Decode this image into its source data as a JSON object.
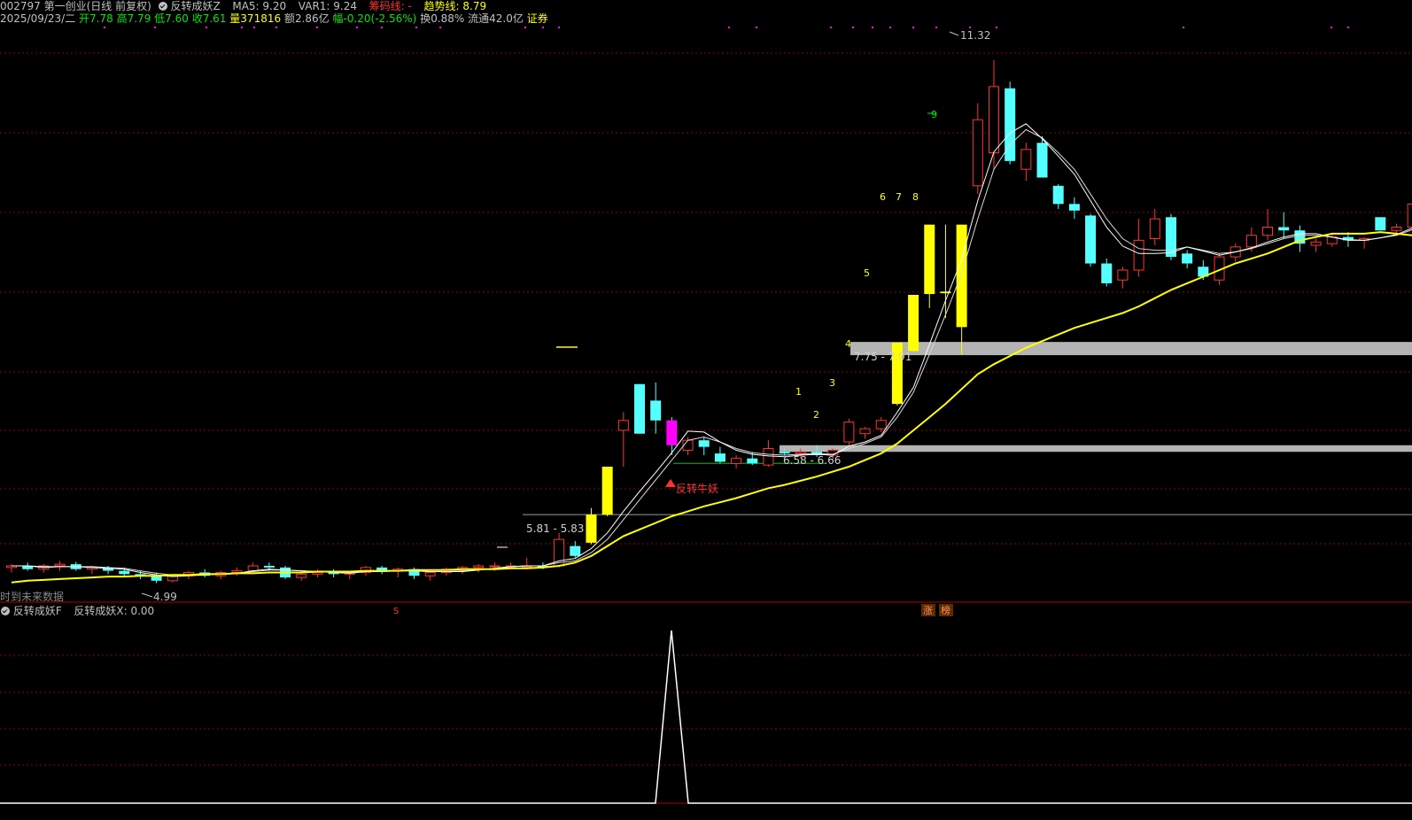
{
  "header": {
    "stock": "002797 第一创业(日线 前复权)",
    "indicator": "反转成妖Z",
    "ma5": "MA5: 9.20",
    "var1": "VAR1: 9.24",
    "chip_line": "筹码线: -",
    "trend_line": "趋势线: 8.79"
  },
  "quote": {
    "date": "2025/09/23/二",
    "open": "开7.78",
    "high": "高7.79",
    "low": "低7.60",
    "close": "收7.61",
    "volume": "量371816",
    "amount": "额2.86亿",
    "change": "幅-0.20(-2.56%)",
    "turnover": "换0.88%",
    "float": "流通42.0亿",
    "sector": "证券"
  },
  "lower": {
    "indicator": "反转成妖F",
    "value": "反转成妖X: 0.00"
  },
  "main_labels": {
    "peak": "11.32",
    "low": "4.99",
    "zone_high": "7.75 - 7.91",
    "zone_mid": "6.58 - 6.66",
    "zone_low": "5.81 - 5.83",
    "signal": "反转牛妖",
    "future": "时到未来数据",
    "s_mark": "S",
    "zhang": "涨",
    "bang": "榜"
  },
  "counts": [
    "1",
    "2",
    "3",
    "4",
    "5",
    "6",
    "7",
    "8",
    "9"
  ],
  "colors": {
    "background": "#000000",
    "up": "#ff3232",
    "down": "#54ffff",
    "signal_bar": "#ffff00",
    "trend_line": "#ffff00",
    "grid": "#8b0000",
    "header_white": "#c0c0c0",
    "header_green": "#00e600",
    "header_yellow": "#ffff00",
    "header_red": "#ff3232",
    "header_magenta": "#ff00ff"
  },
  "chart_data": {
    "type": "candlestick",
    "title": "002797 第一创业(日线 前复权)",
    "peak_annotation": 11.32,
    "low_annotation": 4.99,
    "ohlc": [
      [
        5.18,
        5.22,
        5.12,
        5.2
      ],
      [
        5.2,
        5.24,
        5.14,
        5.16
      ],
      [
        5.16,
        5.22,
        5.12,
        5.2
      ],
      [
        5.2,
        5.26,
        5.14,
        5.22
      ],
      [
        5.22,
        5.25,
        5.14,
        5.16
      ],
      [
        5.16,
        5.2,
        5.1,
        5.18
      ],
      [
        5.18,
        5.2,
        5.1,
        5.14
      ],
      [
        5.14,
        5.18,
        5.08,
        5.1
      ],
      [
        5.1,
        5.14,
        5.04,
        5.08
      ],
      [
        5.08,
        5.12,
        4.99,
        5.02
      ],
      [
        5.02,
        5.1,
        5.0,
        5.08
      ],
      [
        5.08,
        5.14,
        5.04,
        5.12
      ],
      [
        5.12,
        5.16,
        5.06,
        5.08
      ],
      [
        5.08,
        5.14,
        5.04,
        5.12
      ],
      [
        5.12,
        5.18,
        5.08,
        5.14
      ],
      [
        5.14,
        5.24,
        5.1,
        5.2
      ],
      [
        5.2,
        5.24,
        5.14,
        5.18
      ],
      [
        5.18,
        5.2,
        5.04,
        5.06
      ],
      [
        5.06,
        5.12,
        5.02,
        5.1
      ],
      [
        5.1,
        5.16,
        5.06,
        5.12
      ],
      [
        5.12,
        5.16,
        5.06,
        5.1
      ],
      [
        5.1,
        5.14,
        5.04,
        5.12
      ],
      [
        5.12,
        5.2,
        5.08,
        5.18
      ],
      [
        5.18,
        5.2,
        5.1,
        5.14
      ],
      [
        5.14,
        5.18,
        5.06,
        5.16
      ],
      [
        5.16,
        5.18,
        5.04,
        5.08
      ],
      [
        5.08,
        5.14,
        5.02,
        5.12
      ],
      [
        5.12,
        5.18,
        5.08,
        5.16
      ],
      [
        5.16,
        5.2,
        5.1,
        5.18
      ],
      [
        5.18,
        5.22,
        5.12,
        5.2
      ],
      [
        5.2,
        5.24,
        5.14,
        5.2
      ],
      [
        5.2,
        5.24,
        5.16,
        5.2
      ],
      [
        5.2,
        5.3,
        5.16,
        5.2
      ],
      [
        5.2,
        5.24,
        5.16,
        5.18
      ],
      [
        5.2,
        5.6,
        5.18,
        5.52
      ],
      [
        5.44,
        5.5,
        5.3,
        5.32
      ],
      [
        5.48,
        5.9,
        5.46,
        5.82
      ],
      [
        5.82,
        6.4,
        5.8,
        6.4
      ],
      [
        6.84,
        7.06,
        6.4,
        6.96
      ],
      [
        7.4,
        7.4,
        6.8,
        6.8
      ],
      [
        7.2,
        7.42,
        6.8,
        6.96
      ],
      [
        6.96,
        7.0,
        6.54,
        6.66
      ],
      [
        6.6,
        6.76,
        6.54,
        6.72
      ],
      [
        6.72,
        6.76,
        6.54,
        6.64
      ],
      [
        6.56,
        6.64,
        6.44,
        6.46
      ],
      [
        6.44,
        6.54,
        6.38,
        6.5
      ],
      [
        6.5,
        6.58,
        6.42,
        6.44
      ],
      [
        6.42,
        6.72,
        6.4,
        6.62
      ],
      [
        6.58,
        6.62,
        6.54,
        6.56
      ],
      [
        6.56,
        6.62,
        6.5,
        6.58
      ],
      [
        6.58,
        6.66,
        6.52,
        6.54
      ],
      [
        6.54,
        6.62,
        6.48,
        6.6
      ],
      [
        6.7,
        6.98,
        6.66,
        6.94
      ],
      [
        6.8,
        6.88,
        6.74,
        6.86
      ],
      [
        6.86,
        7.0,
        6.82,
        6.96
      ],
      [
        7.16,
        7.9,
        7.14,
        7.9
      ],
      [
        7.8,
        8.48,
        7.8,
        8.48
      ],
      [
        9.33,
        9.33,
        8.32,
        8.49
      ],
      [
        8.5,
        9.33,
        8.2,
        8.52
      ],
      [
        8.09,
        9.33,
        7.76,
        9.33
      ],
      [
        9.8,
        10.8,
        9.7,
        10.6
      ],
      [
        10.2,
        11.32,
        10.0,
        11.0
      ],
      [
        10.98,
        11.06,
        10.06,
        10.1
      ],
      [
        10.0,
        10.32,
        9.86,
        10.24
      ],
      [
        10.32,
        10.4,
        9.9,
        9.9
      ],
      [
        9.8,
        9.82,
        9.52,
        9.58
      ],
      [
        9.58,
        9.66,
        9.4,
        9.5
      ],
      [
        9.44,
        9.46,
        8.82,
        8.86
      ],
      [
        8.86,
        8.92,
        8.58,
        8.62
      ],
      [
        8.66,
        8.82,
        8.56,
        8.78
      ],
      [
        8.78,
        9.4,
        8.7,
        9.14
      ],
      [
        9.16,
        9.52,
        9.08,
        9.4
      ],
      [
        9.42,
        9.46,
        8.9,
        8.94
      ],
      [
        8.98,
        9.02,
        8.8,
        8.86
      ],
      [
        8.82,
        8.9,
        8.66,
        8.7
      ],
      [
        8.66,
        8.98,
        8.6,
        8.94
      ],
      [
        8.94,
        9.1,
        8.88,
        9.06
      ],
      [
        9.06,
        9.3,
        9.0,
        9.2
      ],
      [
        9.2,
        9.52,
        9.14,
        9.3
      ],
      [
        9.3,
        9.48,
        9.16,
        9.26
      ],
      [
        9.26,
        9.32,
        9.0,
        9.1
      ],
      [
        9.08,
        9.16,
        9.0,
        9.12
      ],
      [
        9.1,
        9.22,
        9.06,
        9.18
      ],
      [
        9.18,
        9.24,
        9.06,
        9.14
      ],
      [
        9.14,
        9.18,
        9.04,
        9.16
      ],
      [
        9.42,
        9.42,
        9.26,
        9.26
      ],
      [
        9.26,
        9.34,
        9.2,
        9.3
      ],
      [
        9.3,
        9.66,
        9.26,
        9.58
      ],
      [
        9.58,
        9.9,
        9.5,
        9.7
      ],
      [
        9.7,
        10.0,
        9.6,
        9.76
      ]
    ],
    "signal_days": [
      36,
      37,
      55,
      56,
      57,
      58,
      59
    ],
    "trend_line": [
      5.0,
      5.02,
      5.03,
      5.04,
      5.05,
      5.06,
      5.07,
      5.07,
      5.08,
      5.08,
      5.09,
      5.09,
      5.1,
      5.1,
      5.11,
      5.11,
      5.12,
      5.12,
      5.12,
      5.13,
      5.13,
      5.13,
      5.14,
      5.14,
      5.14,
      5.15,
      5.15,
      5.15,
      5.16,
      5.16,
      5.16,
      5.17,
      5.17,
      5.18,
      5.2,
      5.24,
      5.32,
      5.44,
      5.56,
      5.64,
      5.72,
      5.8,
      5.86,
      5.92,
      5.97,
      6.02,
      6.08,
      6.14,
      6.18,
      6.23,
      6.28,
      6.34,
      6.4,
      6.48,
      6.56,
      6.68,
      6.84,
      7.0,
      7.16,
      7.34,
      7.52,
      7.64,
      7.74,
      7.84,
      7.92,
      8.0,
      8.08,
      8.14,
      8.2,
      8.26,
      8.34,
      8.44,
      8.54,
      8.62,
      8.7,
      8.78,
      8.86,
      8.92,
      8.98,
      9.06,
      9.14,
      9.18,
      9.22,
      9.22,
      9.22,
      9.24,
      9.22,
      9.2,
      9.12,
      9.12,
      9.12
    ],
    "ma5": [
      5.2,
      5.2,
      5.18,
      5.19,
      5.19,
      5.18,
      5.17,
      5.16,
      5.12,
      5.09,
      5.07,
      5.08,
      5.09,
      5.1,
      5.11,
      5.14,
      5.16,
      5.15,
      5.14,
      5.13,
      5.12,
      5.11,
      5.13,
      5.13,
      5.14,
      5.14,
      5.13,
      5.13,
      5.13,
      5.15,
      5.17,
      5.19,
      5.2,
      5.2,
      5.26,
      5.29,
      5.41,
      5.6,
      5.86,
      6.1,
      6.33,
      6.57,
      6.83,
      6.82,
      6.7,
      6.6,
      6.55,
      6.53,
      6.52,
      6.54,
      6.55,
      6.54,
      6.65,
      6.7,
      6.78,
      7.06,
      7.36,
      7.88,
      8.41,
      8.91,
      9.62,
      10.21,
      10.44,
      10.55,
      10.37,
      10.16,
      9.94,
      9.62,
      9.3,
      9.07,
      8.98,
      8.98,
      8.99,
      9.06,
      9.01,
      8.96,
      9.0,
      9.05,
      9.12,
      9.18,
      9.22,
      9.22,
      9.18,
      9.14,
      9.14,
      9.17,
      9.21,
      9.29,
      9.43,
      9.55
    ],
    "var1": [
      5.2,
      5.2,
      5.19,
      5.19,
      5.19,
      5.19,
      5.18,
      5.17,
      5.14,
      5.11,
      5.09,
      5.09,
      5.09,
      5.1,
      5.11,
      5.13,
      5.15,
      5.15,
      5.14,
      5.13,
      5.13,
      5.12,
      5.13,
      5.13,
      5.14,
      5.14,
      5.13,
      5.13,
      5.14,
      5.15,
      5.17,
      5.19,
      5.2,
      5.2,
      5.24,
      5.26,
      5.36,
      5.52,
      5.76,
      6.0,
      6.24,
      6.48,
      6.72,
      6.76,
      6.7,
      6.62,
      6.57,
      6.55,
      6.54,
      6.55,
      6.56,
      6.55,
      6.62,
      6.68,
      6.76,
      7.0,
      7.3,
      7.76,
      8.24,
      8.74,
      9.4,
      10.0,
      10.3,
      10.48,
      10.38,
      10.2,
      10.0,
      9.7,
      9.4,
      9.16,
      9.04,
      9.02,
      9.02,
      9.06,
      9.02,
      8.98,
      9.0,
      9.04,
      9.1,
      9.16,
      9.2,
      9.2,
      9.18,
      9.15,
      9.14,
      9.17,
      9.2,
      9.27,
      9.38,
      9.5
    ],
    "zones": [
      [
        7.75,
        7.91
      ],
      [
        6.58,
        6.66
      ],
      [
        5.81,
        5.83
      ]
    ],
    "lower_indicator": {
      "name": "反转成妖X",
      "spike_day": 38,
      "spike_value": 1
    }
  }
}
